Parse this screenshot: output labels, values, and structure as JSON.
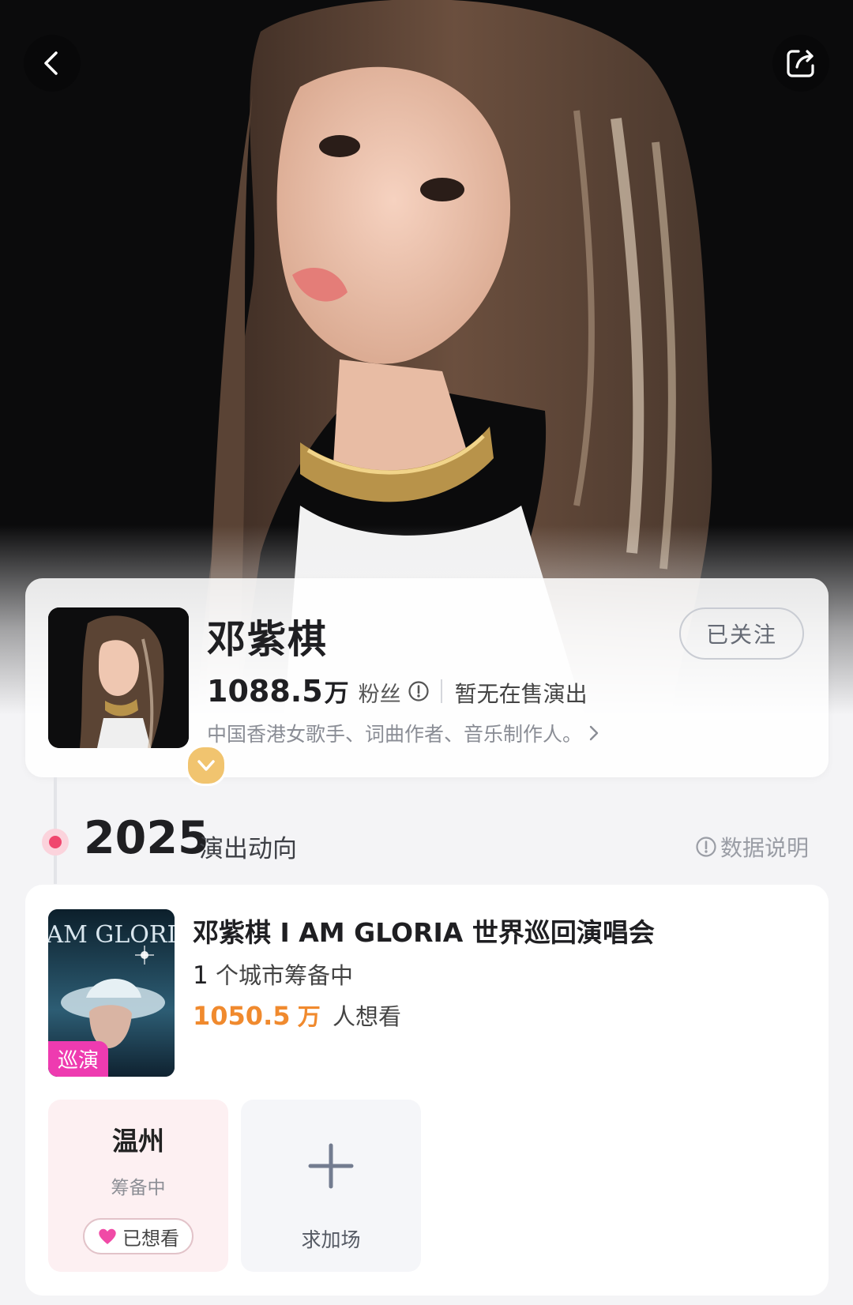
{
  "artist": {
    "name": "邓紫棋",
    "follow_label": "已关注",
    "fans_count": "1088.5",
    "fans_unit": "万",
    "fans_label": "粉丝",
    "no_show_text": "暂无在售演出",
    "bio": "中国香港女歌手、词曲作者、音乐制作人。"
  },
  "timeline": {
    "year": "2025",
    "section_title": "演出动向",
    "data_note": "数据说明"
  },
  "tour": {
    "title": "邓紫棋 I AM GLORIA 世界巡回演唱会",
    "cities_count": "1",
    "cities_text": "个城市筹备中",
    "want_count": "1050.5",
    "want_unit": "万",
    "want_text": "人想看",
    "tag": "巡演",
    "poster_title": "I AM GLORIA"
  },
  "cities": [
    {
      "name": "温州",
      "status": "筹备中",
      "wanted_label": "已想看"
    }
  ],
  "add_show": {
    "label": "求加场"
  },
  "colors": {
    "accent_pink": "#f0476e",
    "want_orange": "#f08a2e",
    "tour_tag": "#ee3bb0",
    "badge_gold": "#f1c46f"
  },
  "icons": [
    "back-icon",
    "share-icon",
    "info-icon",
    "chevron-right-icon",
    "verified-icon",
    "heart-icon",
    "plus-icon"
  ]
}
